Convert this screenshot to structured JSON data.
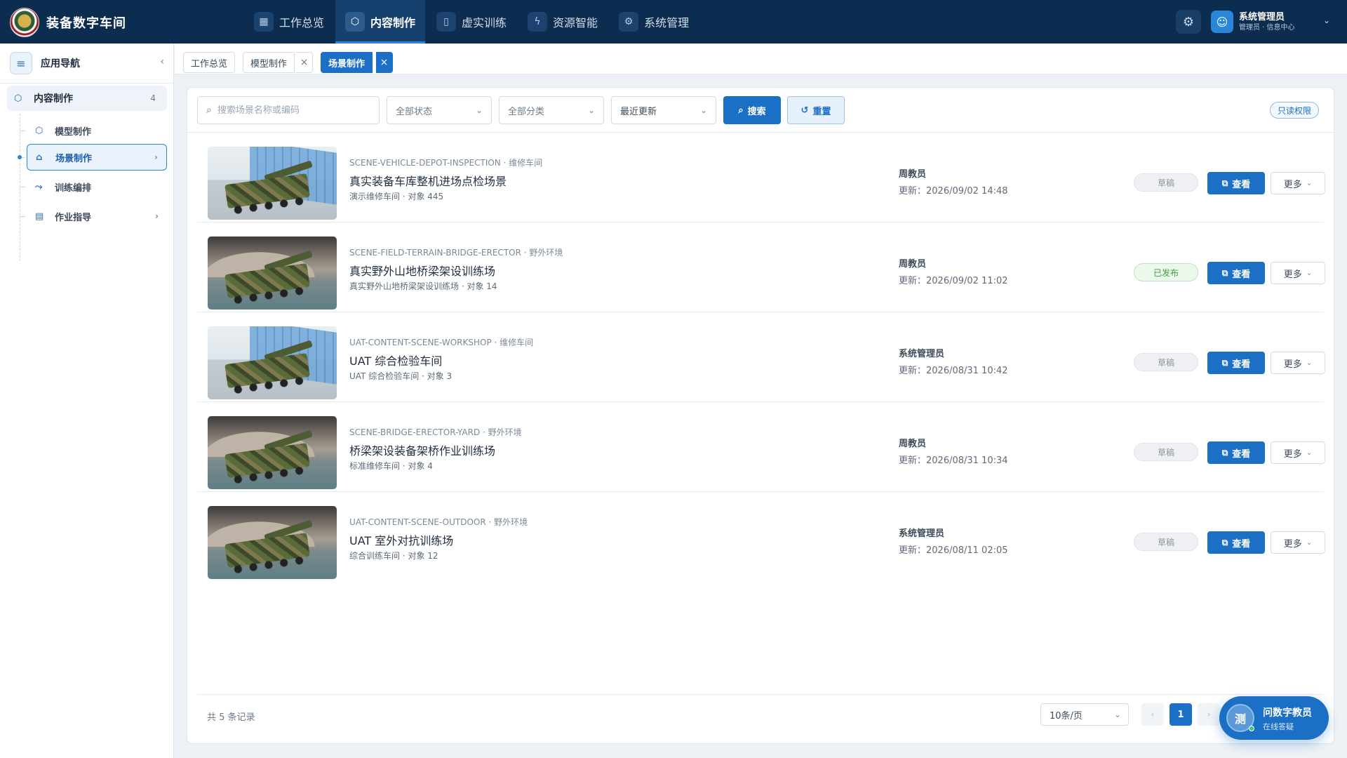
{
  "app": {
    "title": "装备数字车间"
  },
  "topnav": [
    {
      "label": "工作总览",
      "icon": "grid-icon"
    },
    {
      "label": "内容制作",
      "icon": "cube-icon",
      "active": true
    },
    {
      "label": "虚实训练",
      "icon": "book-icon"
    },
    {
      "label": "资源智能",
      "icon": "lightning-icon"
    },
    {
      "label": "系统管理",
      "icon": "gear-icon"
    }
  ],
  "user": {
    "name": "系统管理员",
    "sub": "管理员 · 信息中心"
  },
  "sidebar": {
    "title": "应用导航",
    "group": {
      "label": "内容制作",
      "count": "4"
    },
    "items": [
      {
        "label": "模型制作",
        "icon": "cube-icon"
      },
      {
        "label": "场景制作",
        "icon": "home-icon",
        "active": true
      },
      {
        "label": "训练编排",
        "icon": "flow-icon"
      },
      {
        "label": "作业指导",
        "icon": "document-icon"
      }
    ]
  },
  "tabs": [
    {
      "label": "工作总览"
    },
    {
      "label": "模型制作",
      "closable": true
    },
    {
      "label": "场景制作",
      "closable": true,
      "active": true
    }
  ],
  "filters": {
    "search_placeholder": "搜索场景名称或编码",
    "status": "全部状态",
    "category": "全部分类",
    "sort": "最近更新",
    "search_label": "搜索",
    "reset_label": "重置",
    "readonly_label": "只读权限"
  },
  "rows": [
    {
      "code": "SCENE-VEHICLE-DEPOT-INSPECTION · 维修车间",
      "title": "真实装备车库整机进场点检场景",
      "sub": "演示维修车间 · 对象 445",
      "owner": "周教员",
      "updated": "更新：2026/09/02 14:48",
      "status": "草稿",
      "thumb": "indoor"
    },
    {
      "code": "SCENE-FIELD-TERRAIN-BRIDGE-ERECTOR · 野外环境",
      "title": "真实野外山地桥梁架设训练场",
      "sub": "真实野外山地桥梁架设训练场 · 对象 14",
      "owner": "周教员",
      "updated": "更新：2026/09/02 11:02",
      "status": "已发布",
      "thumb": "outdoor"
    },
    {
      "code": "UAT-CONTENT-SCENE-WORKSHOP · 维修车间",
      "title": "UAT 综合检验车间",
      "sub": "UAT 综合检验车间 · 对象 3",
      "owner": "系统管理员",
      "updated": "更新：2026/08/31 10:42",
      "status": "草稿",
      "thumb": "indoor"
    },
    {
      "code": "SCENE-BRIDGE-ERECTOR-YARD · 野外环境",
      "title": "桥梁架设装备架桥作业训练场",
      "sub": "标准维修车间 · 对象 4",
      "owner": "周教员",
      "updated": "更新：2026/08/31 10:34",
      "status": "草稿",
      "thumb": "outdoor"
    },
    {
      "code": "UAT-CONTENT-SCENE-OUTDOOR · 野外环境",
      "title": "UAT 室外对抗训练场",
      "sub": "综合训练车间 · 对象 12",
      "owner": "系统管理员",
      "updated": "更新：2026/08/11 02:05",
      "status": "草稿",
      "thumb": "outdoor"
    }
  ],
  "row_actions": {
    "view": "查看",
    "more": "更多"
  },
  "footer": {
    "total": "共 5 条记录",
    "page_size": "10条/页",
    "current_page": "1"
  },
  "assistant": {
    "avatar": "测",
    "name": "问数字教员",
    "sub": "在线答疑"
  },
  "colors": {
    "topbar": "#0c2d4f",
    "primary": "#1b6fc4",
    "published": "#3f9a3a"
  }
}
